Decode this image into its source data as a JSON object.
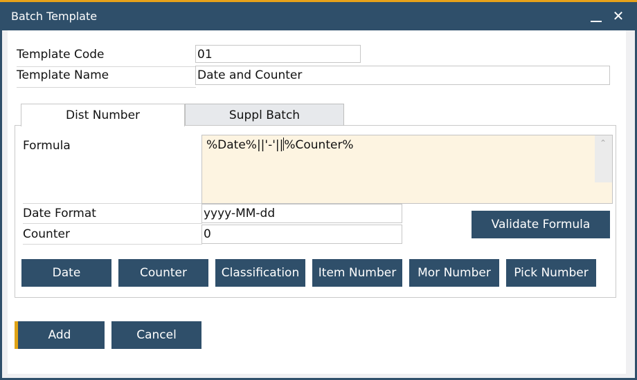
{
  "window": {
    "title": "Batch Template",
    "minimize_icon": "minimize-icon",
    "close_icon": "close-icon",
    "close_glyph": "✕"
  },
  "header_fields": {
    "template_code": {
      "label": "Template Code",
      "value": "01"
    },
    "template_name": {
      "label": "Template Name",
      "value": "Date and Counter"
    }
  },
  "tabs": [
    {
      "label": "Dist Number",
      "active": true
    },
    {
      "label": "Suppl Batch",
      "active": false
    }
  ],
  "dist_number": {
    "formula": {
      "label": "Formula",
      "value_before_caret": "%Date%||'-'||",
      "value_after_caret": "%Counter%",
      "scroll_up_glyph": "⌃"
    },
    "date_format": {
      "label": "Date Format",
      "value": "yyyy-MM-dd"
    },
    "counter": {
      "label": "Counter",
      "value": "0"
    },
    "validate_button": "Validate Formula",
    "insert_buttons": [
      "Date",
      "Counter",
      "Classification",
      "Item Number",
      "Mor Number",
      "Pick Number"
    ]
  },
  "footer": {
    "add_label": "Add",
    "cancel_label": "Cancel"
  },
  "colors": {
    "primary": "#2f4f6a",
    "accent": "#e8a21a",
    "formula_bg": "#fdf4e1"
  }
}
